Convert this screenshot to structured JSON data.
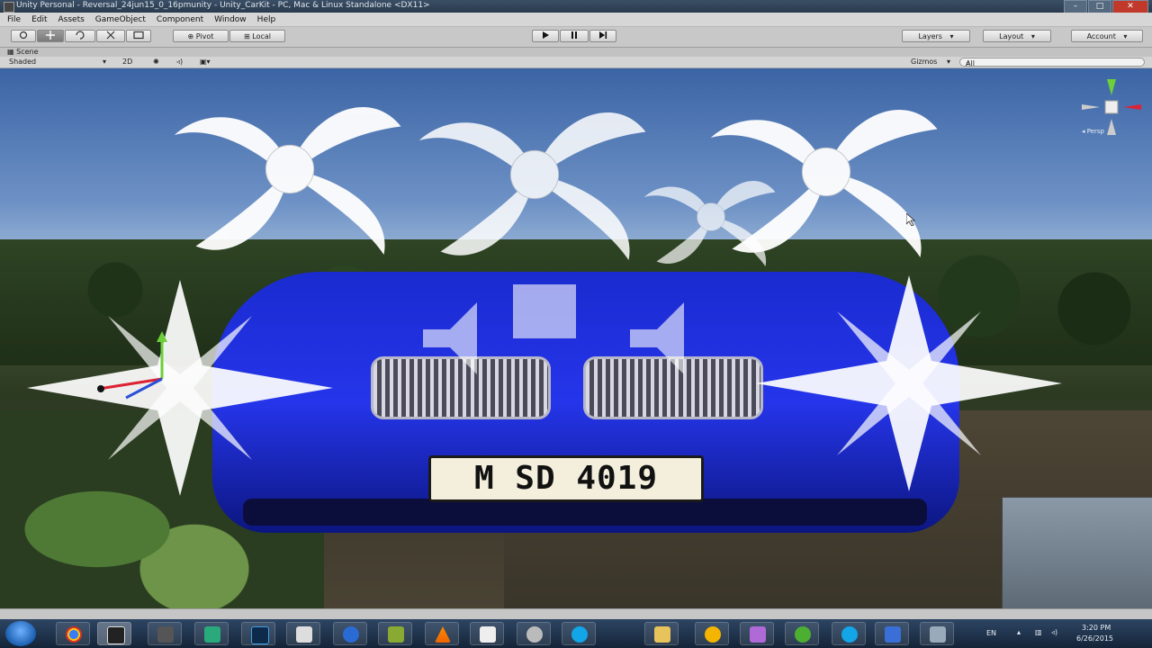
{
  "window": {
    "title": "Unity Personal - Reversal_24jun15_0_16pmunity - Unity_CarKit - PC, Mac & Linux Standalone <DX11>",
    "controls": [
      "–",
      "□",
      "✕"
    ]
  },
  "menu": [
    "File",
    "Edit",
    "Assets",
    "GameObject",
    "Component",
    "Window",
    "Help"
  ],
  "toolbar": {
    "transform_tools": [
      "hand-tool-icon",
      "move-tool-icon",
      "rotate-tool-icon",
      "scale-tool-icon",
      "rect-tool-icon"
    ],
    "pivot_label": "Pivot",
    "local_label": "Local",
    "play_controls": [
      "play-icon",
      "pause-icon",
      "step-icon"
    ],
    "layers_label": "Layers",
    "layout_label": "Layout",
    "account_label": "Account"
  },
  "scene": {
    "tab_label": "Scene",
    "shading_mode": "Shaded",
    "mode_2d": "2D",
    "gizmos_label": "Gizmos",
    "search_placeholder": "All",
    "persp_label": "Persp",
    "license_plate": "M SD 4019"
  },
  "taskbar": {
    "apps": [
      "chrome",
      "unity",
      "app-3",
      "app-4",
      "photoshop",
      "zbrush",
      "app-7",
      "app-8",
      "vlc",
      "app-10",
      "app-11",
      "skype-1",
      "folder",
      "app-14",
      "app-15",
      "utorrent",
      "skype-2",
      "app-18",
      "app-19"
    ],
    "language": "EN",
    "clock_time": "3:20 PM",
    "clock_date": "6/26/2015"
  },
  "colors": {
    "car_blue": "#2535ea",
    "editor_gray": "#c8c8c8",
    "taskbar": "#1c2f47"
  }
}
